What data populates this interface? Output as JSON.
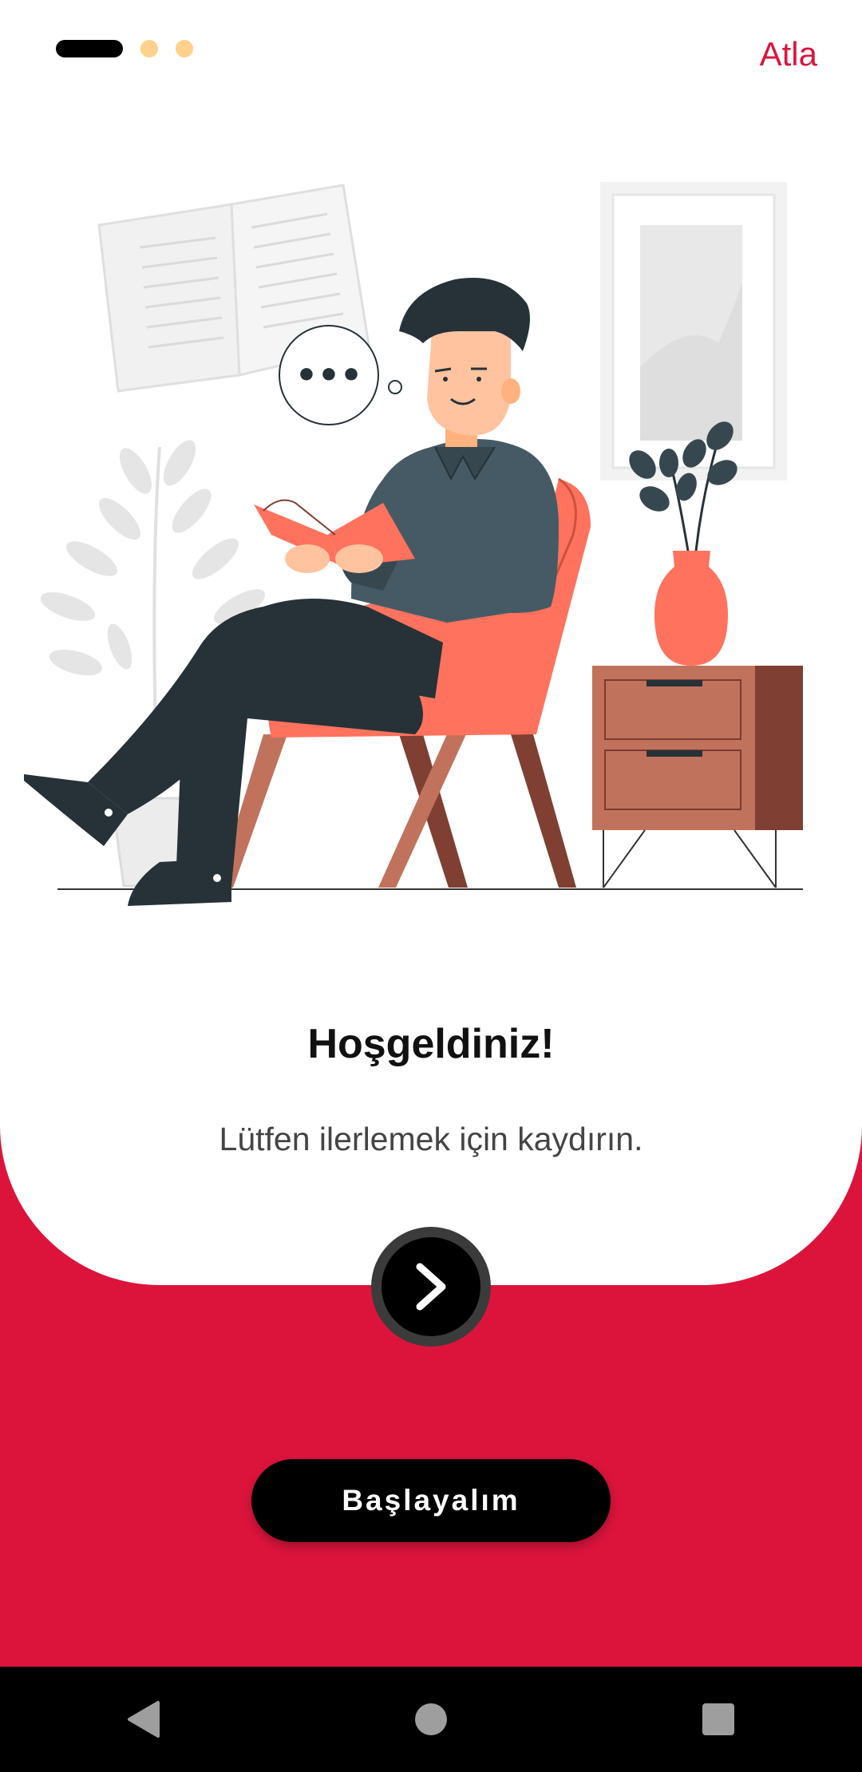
{
  "onboarding": {
    "skip_label": "Atla",
    "title": "Hoşgeldiniz!",
    "subtitle": "Lütfen ilerlemek için kaydırın.",
    "start_label": "Başlayalım",
    "page_count": 3,
    "current_page": 1
  },
  "illustration": {
    "thought_bubble_text": "•••"
  },
  "colors": {
    "accent": "#DC143C",
    "inactive_dot": "#FFD18C",
    "button": "#000000",
    "chair": "#FF725E"
  },
  "icons": {
    "next": "chevron-right-icon",
    "back": "back-triangle-icon",
    "home": "home-circle-icon",
    "recents": "recents-square-icon"
  }
}
